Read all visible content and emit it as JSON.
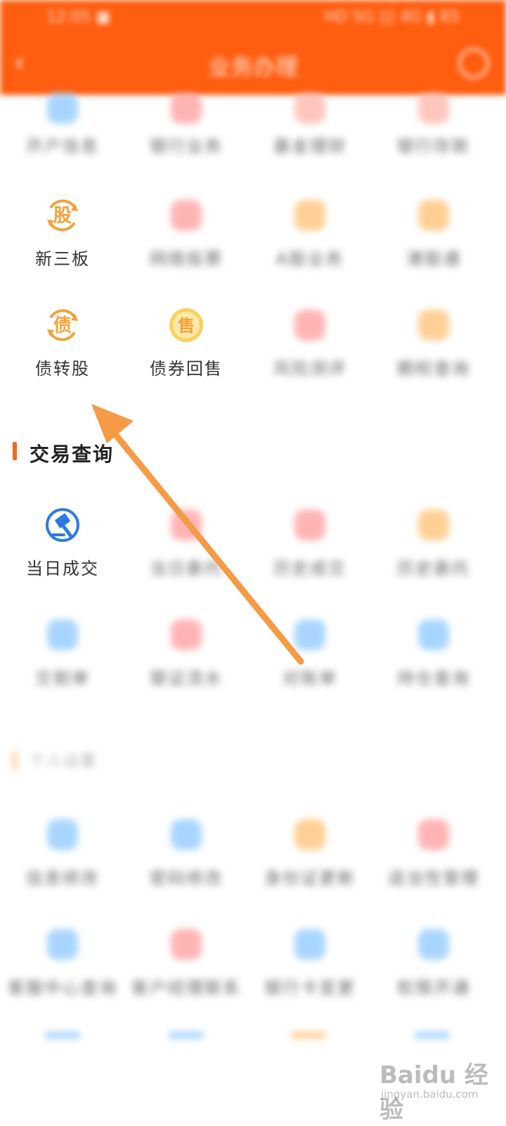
{
  "header": {
    "status_time": "12:05 ■",
    "status_right": "HD 5G ||| 4G ▮ 85",
    "back": "‹",
    "title": "业务办理"
  },
  "section_top": {
    "row0": [
      {
        "label": "开户信息",
        "icon": "blue-square-icon",
        "color": "#8cc8ff"
      },
      {
        "label": "银行业务",
        "icon": "red-card-icon",
        "color": "#ff9b9b"
      },
      {
        "label": "基金理财",
        "icon": "red-heart-icon",
        "color": "#ffb3a8"
      },
      {
        "label": "银行存款",
        "icon": "red-bag-icon",
        "color": "#ffb3a8"
      }
    ],
    "row1": [
      {
        "label": "新三板",
        "icon": "gu-stock-icon",
        "glyph": "股",
        "color": "#f3a23a",
        "clear": true
      },
      {
        "label": "网络投票",
        "icon": "red-vote-icon",
        "color": "#ff9b9b"
      },
      {
        "label": "A股业务",
        "icon": "orange-circle-icon",
        "color": "#ffc072"
      },
      {
        "label": "港股通",
        "icon": "orange-circle-icon",
        "color": "#ffc072"
      }
    ],
    "row2": [
      {
        "label": "债转股",
        "icon": "zhai-bond-icon",
        "glyph": "债",
        "color": "#f3a23a",
        "clear": true
      },
      {
        "label": "债券回售",
        "icon": "shou-sale-icon",
        "glyph": "售",
        "color": "#f3a23a",
        "clear": true
      },
      {
        "label": "风险测评",
        "icon": "red-leaf-icon",
        "color": "#ff9b9b"
      },
      {
        "label": "期权查询",
        "icon": "orange-circle-icon",
        "color": "#ffc072"
      }
    ]
  },
  "section_trade": {
    "title": "交易查询",
    "row0": [
      {
        "label": "当日成交",
        "icon": "hammer-trade-icon",
        "color": "#2d7be0",
        "clear": true
      },
      {
        "label": "当日委托",
        "icon": "red-document-icon",
        "color": "#ff9b9b"
      },
      {
        "label": "历史成交",
        "icon": "red-circle-icon",
        "color": "#ff9b9b"
      },
      {
        "label": "历史委托",
        "icon": "orange-folder-icon",
        "color": "#ffc072"
      }
    ],
    "row1": [
      {
        "label": "交割单",
        "icon": "blue-jiao-icon",
        "color": "#8cc8ff"
      },
      {
        "label": "银证流水",
        "icon": "red-bill-icon",
        "color": "#ff9b9b"
      },
      {
        "label": "对账单",
        "icon": "blue-book-icon",
        "color": "#8cc8ff"
      },
      {
        "label": "持仓查询",
        "icon": "blue-circle-icon",
        "color": "#8cc8ff"
      }
    ]
  },
  "section_personal": {
    "title": "个人设置",
    "row0": [
      {
        "label": "信息修改",
        "icon": "blue-shield-icon",
        "color": "#8cc8ff"
      },
      {
        "label": "密码修改",
        "icon": "blue-person-icon",
        "color": "#8cc8ff"
      },
      {
        "label": "身份证更新",
        "icon": "orange-id-icon",
        "color": "#ffc072"
      },
      {
        "label": "适当性管理",
        "icon": "red-shield-icon",
        "color": "#ff9b9b"
      }
    ],
    "row1": [
      {
        "label": "客服中心查询",
        "icon": "blue-phone-icon",
        "color": "#8cc8ff"
      },
      {
        "label": "客户经理联系",
        "icon": "red-card-icon",
        "color": "#ff9b9b"
      },
      {
        "label": "银行卡变更",
        "icon": "blue-card-icon",
        "color": "#8cc8ff"
      },
      {
        "label": "权限开通",
        "icon": "blue-person-icon",
        "color": "#8cc8ff"
      }
    ]
  },
  "watermark": {
    "brand": "Baidu 经验",
    "sub": "jingyan.baidu.com"
  },
  "colors": {
    "header": "#ff5d0f",
    "accent": "#f26a1b",
    "arrow": "#f59a45",
    "bond_icon": "#f3a23a",
    "trade_icon": "#2d7be0"
  }
}
